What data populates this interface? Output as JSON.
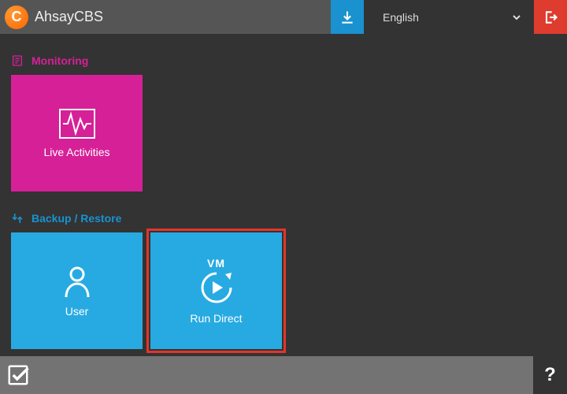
{
  "brand": {
    "name": "AhsayCBS",
    "logo_letter": "C"
  },
  "topbar": {
    "language": "English"
  },
  "sections": {
    "monitoring": {
      "title": "Monitoring",
      "tiles": {
        "live_activities": "Live Activities"
      }
    },
    "backup_restore": {
      "title": "Backup / Restore",
      "tiles": {
        "user": "User",
        "run_direct": {
          "small": "VM",
          "label": "Run Direct"
        }
      }
    }
  },
  "bottombar": {
    "help": "?"
  },
  "colors": {
    "brand_pink": "#d62098",
    "brand_blue": "#27aae1",
    "header_blue": "#1992cf",
    "logout_red": "#de3c2f",
    "highlight_red": "#e4342a"
  }
}
